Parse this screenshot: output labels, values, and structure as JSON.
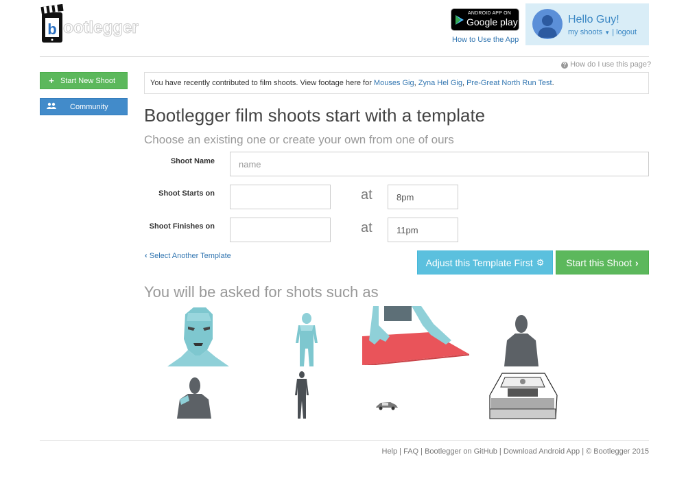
{
  "header": {
    "logo_text": "bootlegger",
    "play_badge_small": "ANDROID APP ON",
    "play_badge_big": "Google play",
    "how_to_link": "How to Use the App",
    "greeting": "Hello Guy!",
    "my_shoots": "my shoots",
    "separator": "|",
    "logout": "logout"
  },
  "sidebar": {
    "start_new_shoot": "Start New Shoot",
    "community": "Community"
  },
  "help_link": "How do I use this page?",
  "notice": {
    "text": "You have recently contributed to film shoots. View footage here for ",
    "links": [
      "Mouses Gig",
      "Zyna Hel Gig",
      "Pre-Great North Run Test"
    ],
    "sep": ", ",
    "end": "."
  },
  "main": {
    "title": "Bootlegger film shoots start with a template",
    "subtitle": "Choose an existing one or create your own from one of ours"
  },
  "form": {
    "shoot_name_label": "Shoot Name",
    "shoot_name_placeholder": "name",
    "starts_label": "Shoot Starts on",
    "starts_date": "",
    "starts_time": "8pm",
    "finishes_label": "Shoot Finishes on",
    "finishes_date": "",
    "finishes_time": "11pm",
    "at": "at"
  },
  "actions": {
    "select_template": "Select Another Template",
    "adjust_template": "Adjust this Template First",
    "start_shoot": "Start this Shoot"
  },
  "shots": {
    "title": "You will be asked for shots such as",
    "items": [
      "face close-up",
      "full body",
      "hands on table",
      "head and shoulders",
      "shoulder silhouette",
      "standing figure",
      "small car",
      "car interior"
    ]
  },
  "footer": {
    "text": "Help | FAQ | Bootlegger on GitHub | Download Android App | © Bootlegger 2015"
  },
  "colors": {
    "success": "#5cb85c",
    "primary": "#428bca",
    "info": "#5bc0de",
    "link": "#3276b1"
  }
}
